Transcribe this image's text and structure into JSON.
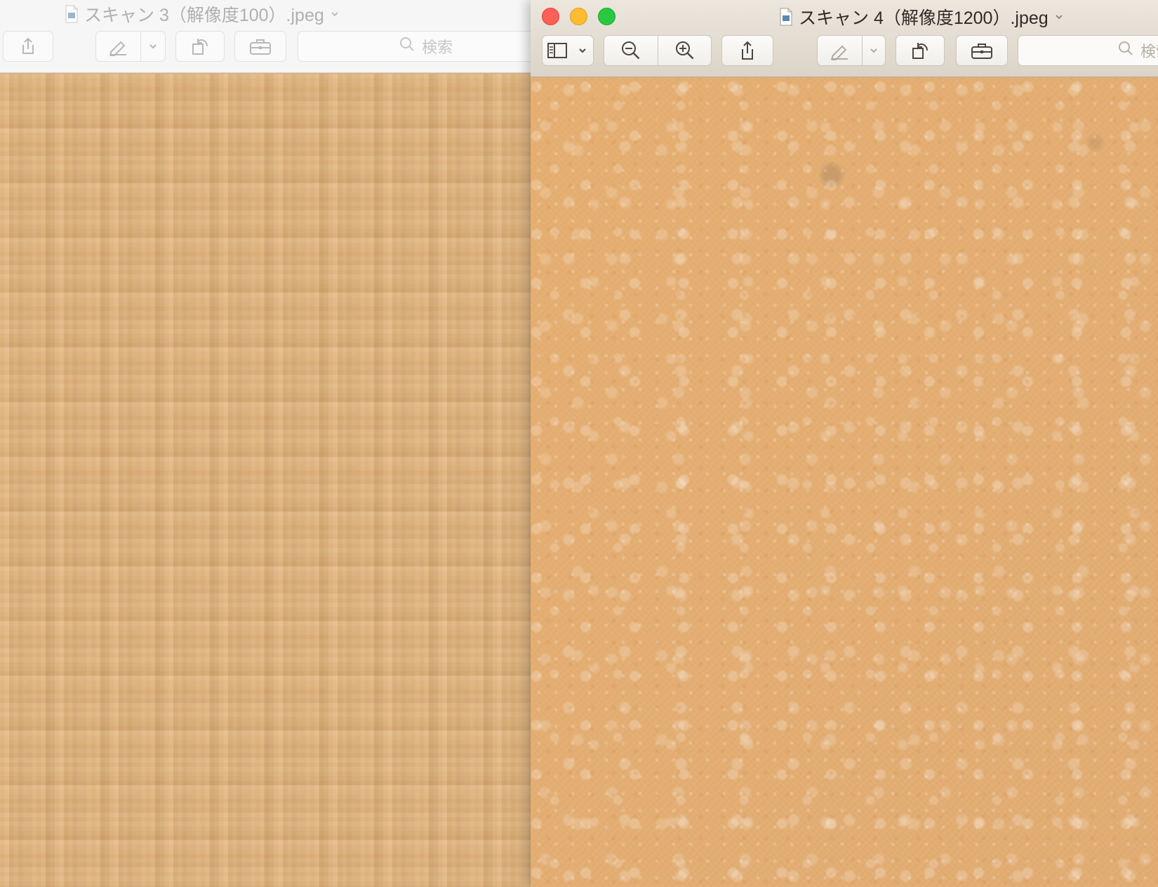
{
  "back_window": {
    "title": "スキャン 3（解像度100）.jpeg",
    "search_placeholder": "検索",
    "state": "inactive",
    "icons": [
      "document-icon",
      "share-icon",
      "markup-pen-icon",
      "chevron-down-icon",
      "rotate-icon",
      "toolbox-icon",
      "search-icon"
    ]
  },
  "front_window": {
    "title": "スキャン 4（解像度1200）.jpeg",
    "search_placeholder": "検索",
    "state": "active",
    "icons": [
      "close-button",
      "minimize-button",
      "zoom-button",
      "document-icon",
      "sidebar-icon",
      "chevron-down-icon",
      "zoom-out-icon",
      "zoom-in-icon",
      "share-icon",
      "markup-pen-icon",
      "rotate-icon",
      "toolbox-icon",
      "search-icon"
    ]
  },
  "colors": {
    "close": "#fe5f57",
    "minimize": "#febc2e",
    "zoom": "#28c840",
    "image_tone": "#e2ad72"
  }
}
